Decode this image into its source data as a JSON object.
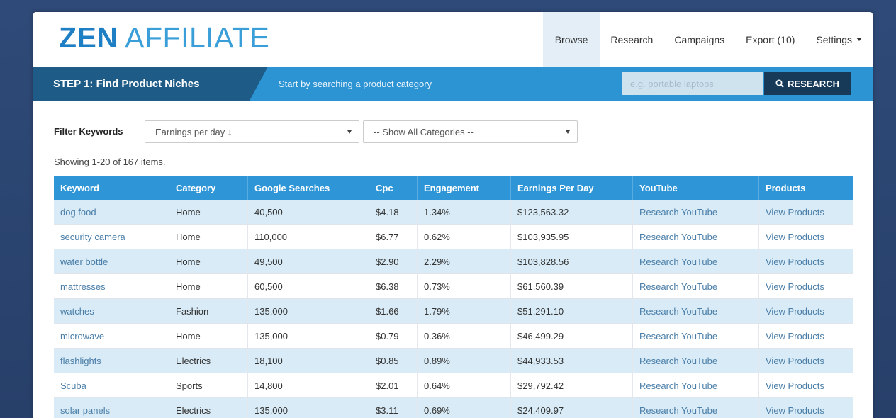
{
  "brand": {
    "logo_bold": "ZEN",
    "logo_light": " AFFILIATE"
  },
  "nav": {
    "items": [
      {
        "label": "Browse",
        "active": true
      },
      {
        "label": "Research"
      },
      {
        "label": "Campaigns"
      },
      {
        "label": "Export (10)"
      },
      {
        "label": "Settings"
      }
    ]
  },
  "step": {
    "title": "STEP 1: Find Product Niches",
    "hint": "Start by searching a product category",
    "search_placeholder": "e.g. portable laptops",
    "research_label": "RESEARCH"
  },
  "filter": {
    "label": "Filter Keywords",
    "sort_value": "Earnings per day ↓",
    "category_value": "-- Show All Categories --"
  },
  "showing": "Showing 1-20 of 167 items.",
  "table": {
    "headers": [
      "Keyword",
      "Category",
      "Google Searches",
      "Cpc",
      "Engagement",
      "Earnings Per Day",
      "YouTube",
      "Products"
    ],
    "rows": [
      [
        "dog food",
        "Home",
        "40,500",
        "$4.18",
        "1.34%",
        "$123,563.32",
        "Research YouTube",
        "View Products"
      ],
      [
        "security camera",
        "Home",
        "110,000",
        "$6.77",
        "0.62%",
        "$103,935.95",
        "Research YouTube",
        "View Products"
      ],
      [
        "water bottle",
        "Home",
        "49,500",
        "$2.90",
        "2.29%",
        "$103,828.56",
        "Research YouTube",
        "View Products"
      ],
      [
        "mattresses",
        "Home",
        "60,500",
        "$6.38",
        "0.73%",
        "$61,560.39",
        "Research YouTube",
        "View Products"
      ],
      [
        "watches",
        "Fashion",
        "135,000",
        "$1.66",
        "1.79%",
        "$51,291.10",
        "Research YouTube",
        "View Products"
      ],
      [
        "microwave",
        "Home",
        "135,000",
        "$0.79",
        "0.36%",
        "$46,499.29",
        "Research YouTube",
        "View Products"
      ],
      [
        "flashlights",
        "Electrics",
        "18,100",
        "$0.85",
        "0.89%",
        "$44,933.53",
        "Research YouTube",
        "View Products"
      ],
      [
        "Scuba",
        "Sports",
        "14,800",
        "$2.01",
        "0.64%",
        "$29,792.42",
        "Research YouTube",
        "View Products"
      ],
      [
        "solar panels",
        "Electrics",
        "135,000",
        "$3.11",
        "0.69%",
        "$24,409.97",
        "Research YouTube",
        "View Products"
      ]
    ]
  },
  "colors": {
    "accent": "#2e95d6",
    "dark": "#1e5b86",
    "button": "#163a58"
  }
}
